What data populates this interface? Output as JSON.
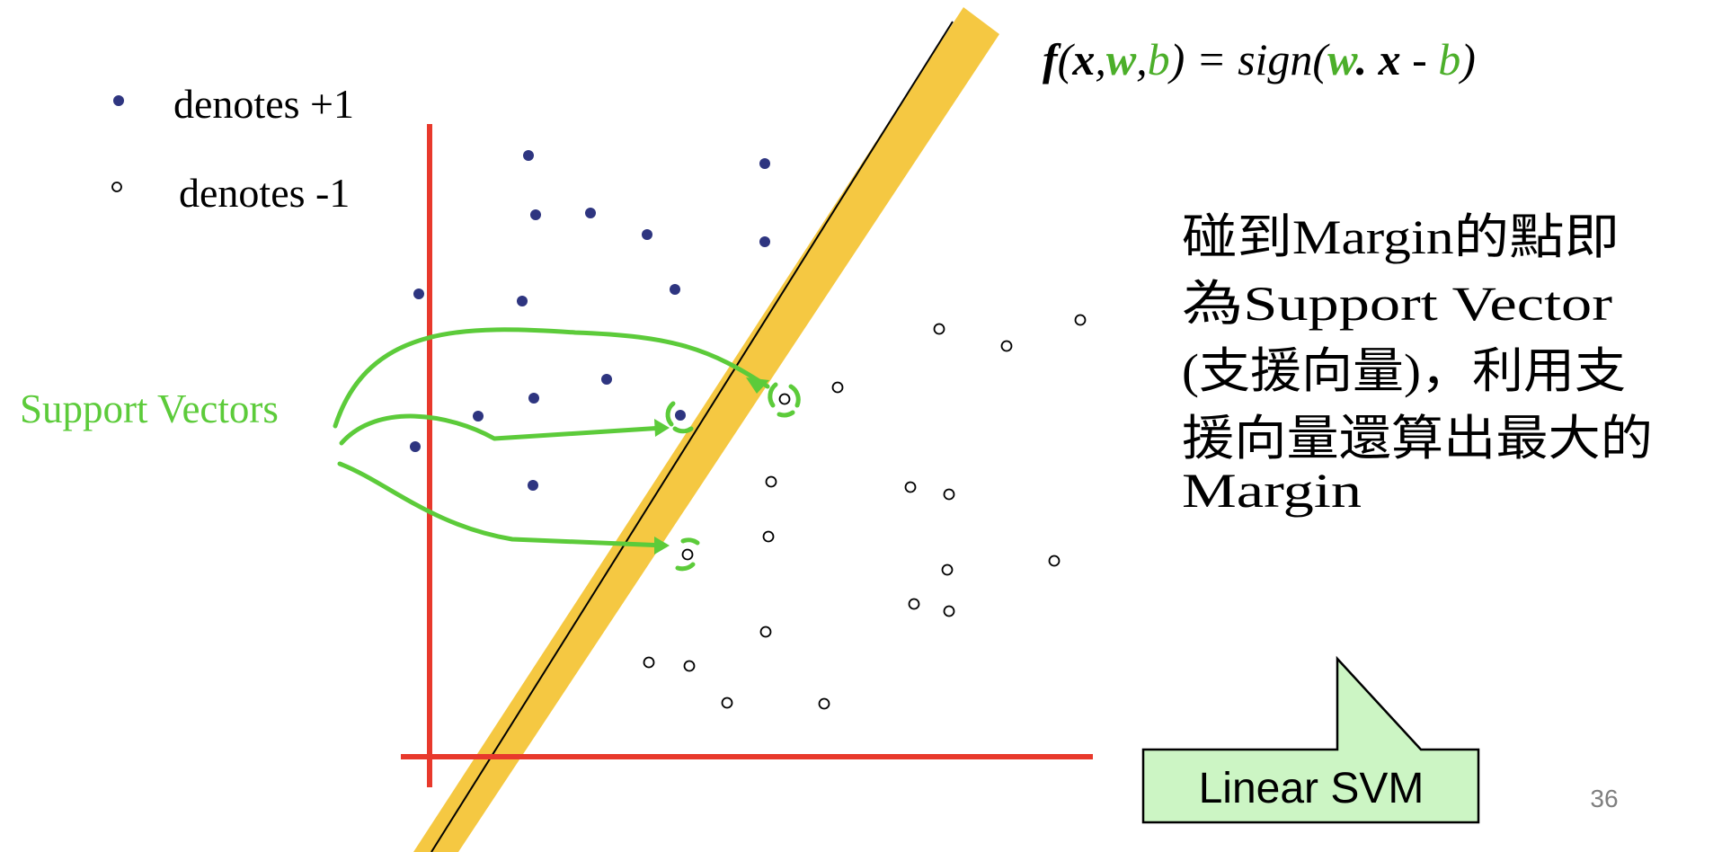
{
  "legend": {
    "positive_label": "denotes +1",
    "negative_label": "denotes -1"
  },
  "formula": {
    "parts": [
      {
        "text": "f",
        "color": "#000000",
        "style": "bold-italic"
      },
      {
        "text": "(",
        "color": "#000000",
        "style": "italic"
      },
      {
        "text": "x",
        "color": "#000000",
        "style": "bold-italic"
      },
      {
        "text": ",",
        "color": "#000000",
        "style": "italic"
      },
      {
        "text": "w",
        "color": "#4caf2a",
        "style": "bold-italic"
      },
      {
        "text": ",",
        "color": "#000000",
        "style": "italic"
      },
      {
        "text": "b",
        "color": "#4caf2a",
        "style": "italic"
      },
      {
        "text": ") = sign(",
        "color": "#000000",
        "style": "italic"
      },
      {
        "text": "w",
        "color": "#4caf2a",
        "style": "bold-italic"
      },
      {
        "text": ". ",
        "color": "#000000",
        "style": "bold-italic"
      },
      {
        "text": "x",
        "color": "#000000",
        "style": "bold-italic"
      },
      {
        "text": " - ",
        "color": "#000000",
        "style": "italic"
      },
      {
        "text": "b",
        "color": "#4caf2a",
        "style": "italic"
      },
      {
        "text": ")",
        "color": "#000000",
        "style": "italic"
      }
    ]
  },
  "support_vectors_label": "Support Vectors",
  "description_lines": [
    "碰到Margin的點即",
    "為Support Vector",
    "(支援向量)，利用支",
    "援向量還算出最大的",
    "Margin"
  ],
  "callout_label": "Linear SVM",
  "page_number": "36",
  "colors": {
    "axes": "#e8392c",
    "margin_band": "#f5c842",
    "positive_point": "#2e3580",
    "annotation_green": "#5ccb3a",
    "callout_fill": "#ccf5c4",
    "page_number": "#7f7f7f"
  }
}
